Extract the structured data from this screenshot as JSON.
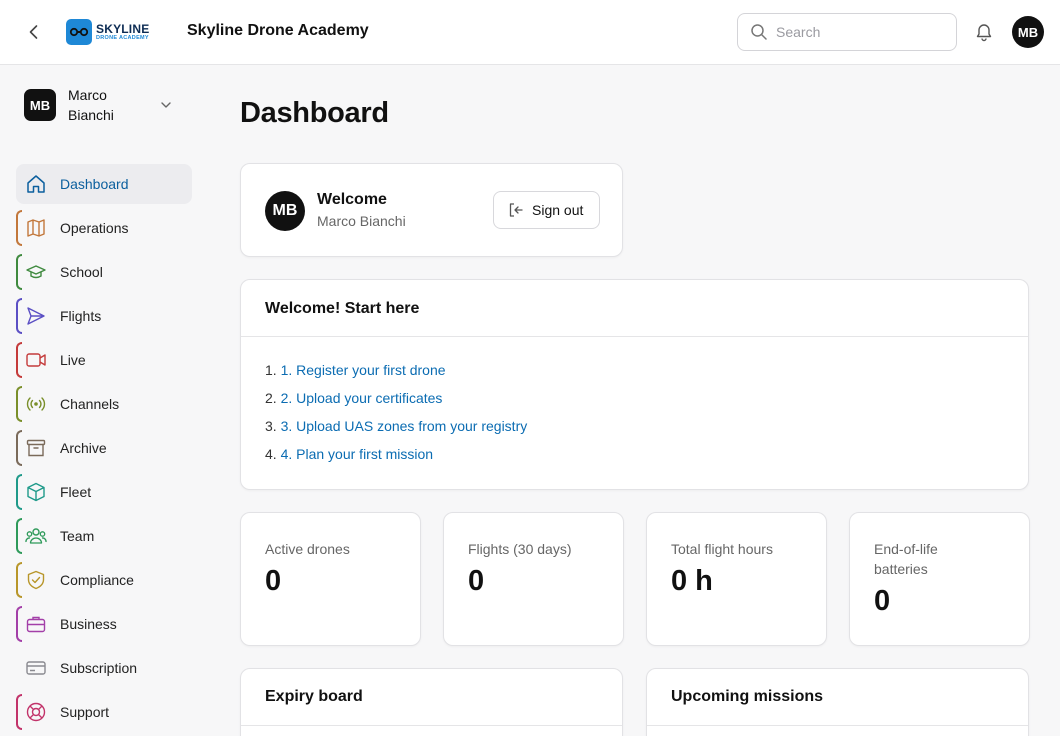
{
  "header": {
    "logo_main": "SKYLINE",
    "logo_sub": "DRONE ACADEMY",
    "title": "Skyline Drone Academy",
    "search_placeholder": "Search",
    "avatar_initials": "MB"
  },
  "sidebar": {
    "user": {
      "initials": "MB",
      "name": "Marco Bianchi"
    },
    "items": [
      {
        "label": "Dashboard",
        "icon": "home-icon",
        "color": "#0b5f9e"
      },
      {
        "label": "Operations",
        "icon": "map-icon",
        "color": "#c2773b"
      },
      {
        "label": "School",
        "icon": "graduation-cap-icon",
        "color": "#3f8a3f"
      },
      {
        "label": "Flights",
        "icon": "send-icon",
        "color": "#5b4fc4"
      },
      {
        "label": "Live",
        "icon": "video-icon",
        "color": "#c43a3a"
      },
      {
        "label": "Channels",
        "icon": "broadcast-icon",
        "color": "#7a8f2a"
      },
      {
        "label": "Archive",
        "icon": "archive-icon",
        "color": "#7a6a5a"
      },
      {
        "label": "Fleet",
        "icon": "box-icon",
        "color": "#1f9a8a"
      },
      {
        "label": "Team",
        "icon": "users-icon",
        "color": "#2e9a5a"
      },
      {
        "label": "Compliance",
        "icon": "shield-check-icon",
        "color": "#b8962a"
      },
      {
        "label": "Business",
        "icon": "briefcase-icon",
        "color": "#a33fa8"
      },
      {
        "label": "Subscription",
        "icon": "credit-card-icon",
        "color": "#8a8a90"
      },
      {
        "label": "Support",
        "icon": "life-buoy-icon",
        "color": "#c2336a"
      }
    ]
  },
  "main": {
    "page_title": "Dashboard",
    "welcome": {
      "initials": "MB",
      "title": "Welcome",
      "name": "Marco Bianchi",
      "sign_out_label": "Sign out"
    },
    "start_here": {
      "title": "Welcome! Start here",
      "steps": [
        {
          "num": "1.",
          "label": "1. Register your first drone"
        },
        {
          "num": "2.",
          "label": "2. Upload your certificates"
        },
        {
          "num": "3.",
          "label": "3. Upload UAS zones from your registry"
        },
        {
          "num": "4.",
          "label": "4. Plan your first mission"
        }
      ]
    },
    "stats": [
      {
        "label": "Active drones",
        "value": "0"
      },
      {
        "label": "Flights (30 days)",
        "value": "0"
      },
      {
        "label": "Total flight hours",
        "value": "0 h"
      },
      {
        "label": "End-of-life batteries",
        "value": "0"
      }
    ],
    "expiry_board_title": "Expiry board",
    "upcoming_missions_title": "Upcoming missions"
  }
}
